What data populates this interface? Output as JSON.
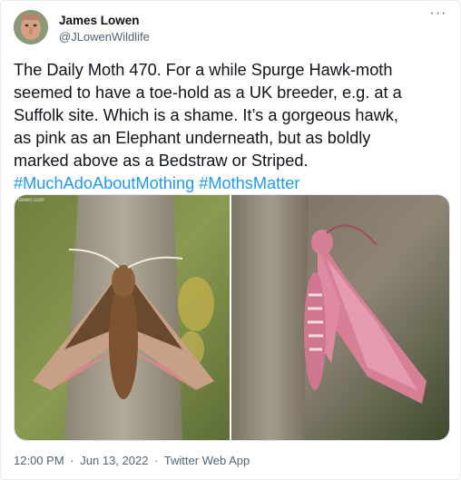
{
  "author": {
    "name": "James Lowen",
    "handle": "@JLowenWildlife",
    "avatar_icon": "user-avatar"
  },
  "more_icon": "more-dots-icon",
  "tweet": {
    "text_lines": [
      "The Daily Moth 470. For a while Spurge Hawk-moth",
      "seemed to have a toe-hold as a UK breeder, e.g. at a",
      "Suffolk site. Which is a shame. It’s a gorgeous hawk,",
      "as pink as an Elephant underneath, but as boldly",
      "marked above as a Bedstraw or Striped."
    ],
    "hashtags": [
      "#MuchAdoAboutMothing",
      "#MothsMatter"
    ]
  },
  "media": {
    "photo_left_credit": "lowen.com",
    "photo_left_alt_icon": "moth-photo-upperside",
    "photo_right_alt_icon": "moth-photo-underside"
  },
  "footer": {
    "time": "12:00 PM",
    "separator": "·",
    "date": "Jun 13, 2022",
    "app": "Twitter Web App"
  },
  "colors": {
    "link": "#1d9bf0",
    "secondary_text": "#536471",
    "primary_text": "#0f1419"
  }
}
